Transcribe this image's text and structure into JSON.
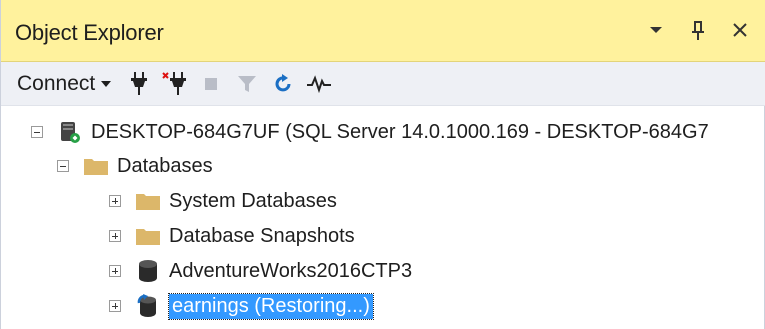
{
  "panel": {
    "title": "Object Explorer"
  },
  "toolbar": {
    "connect_label": "Connect"
  },
  "tree": {
    "server": {
      "label": "DESKTOP-684G7UF (SQL Server 14.0.1000.169 - DESKTOP-684G7"
    },
    "databases": {
      "label": "Databases"
    },
    "items": [
      {
        "label": "System Databases"
      },
      {
        "label": "Database Snapshots"
      },
      {
        "label": "AdventureWorks2016CTP3"
      },
      {
        "label": "earnings (Restoring...)"
      }
    ]
  },
  "colors": {
    "title_bar": "#fff29d",
    "toolbar": "#eef0f5",
    "selection": "#3399ff",
    "folder": "#dcb76a"
  }
}
